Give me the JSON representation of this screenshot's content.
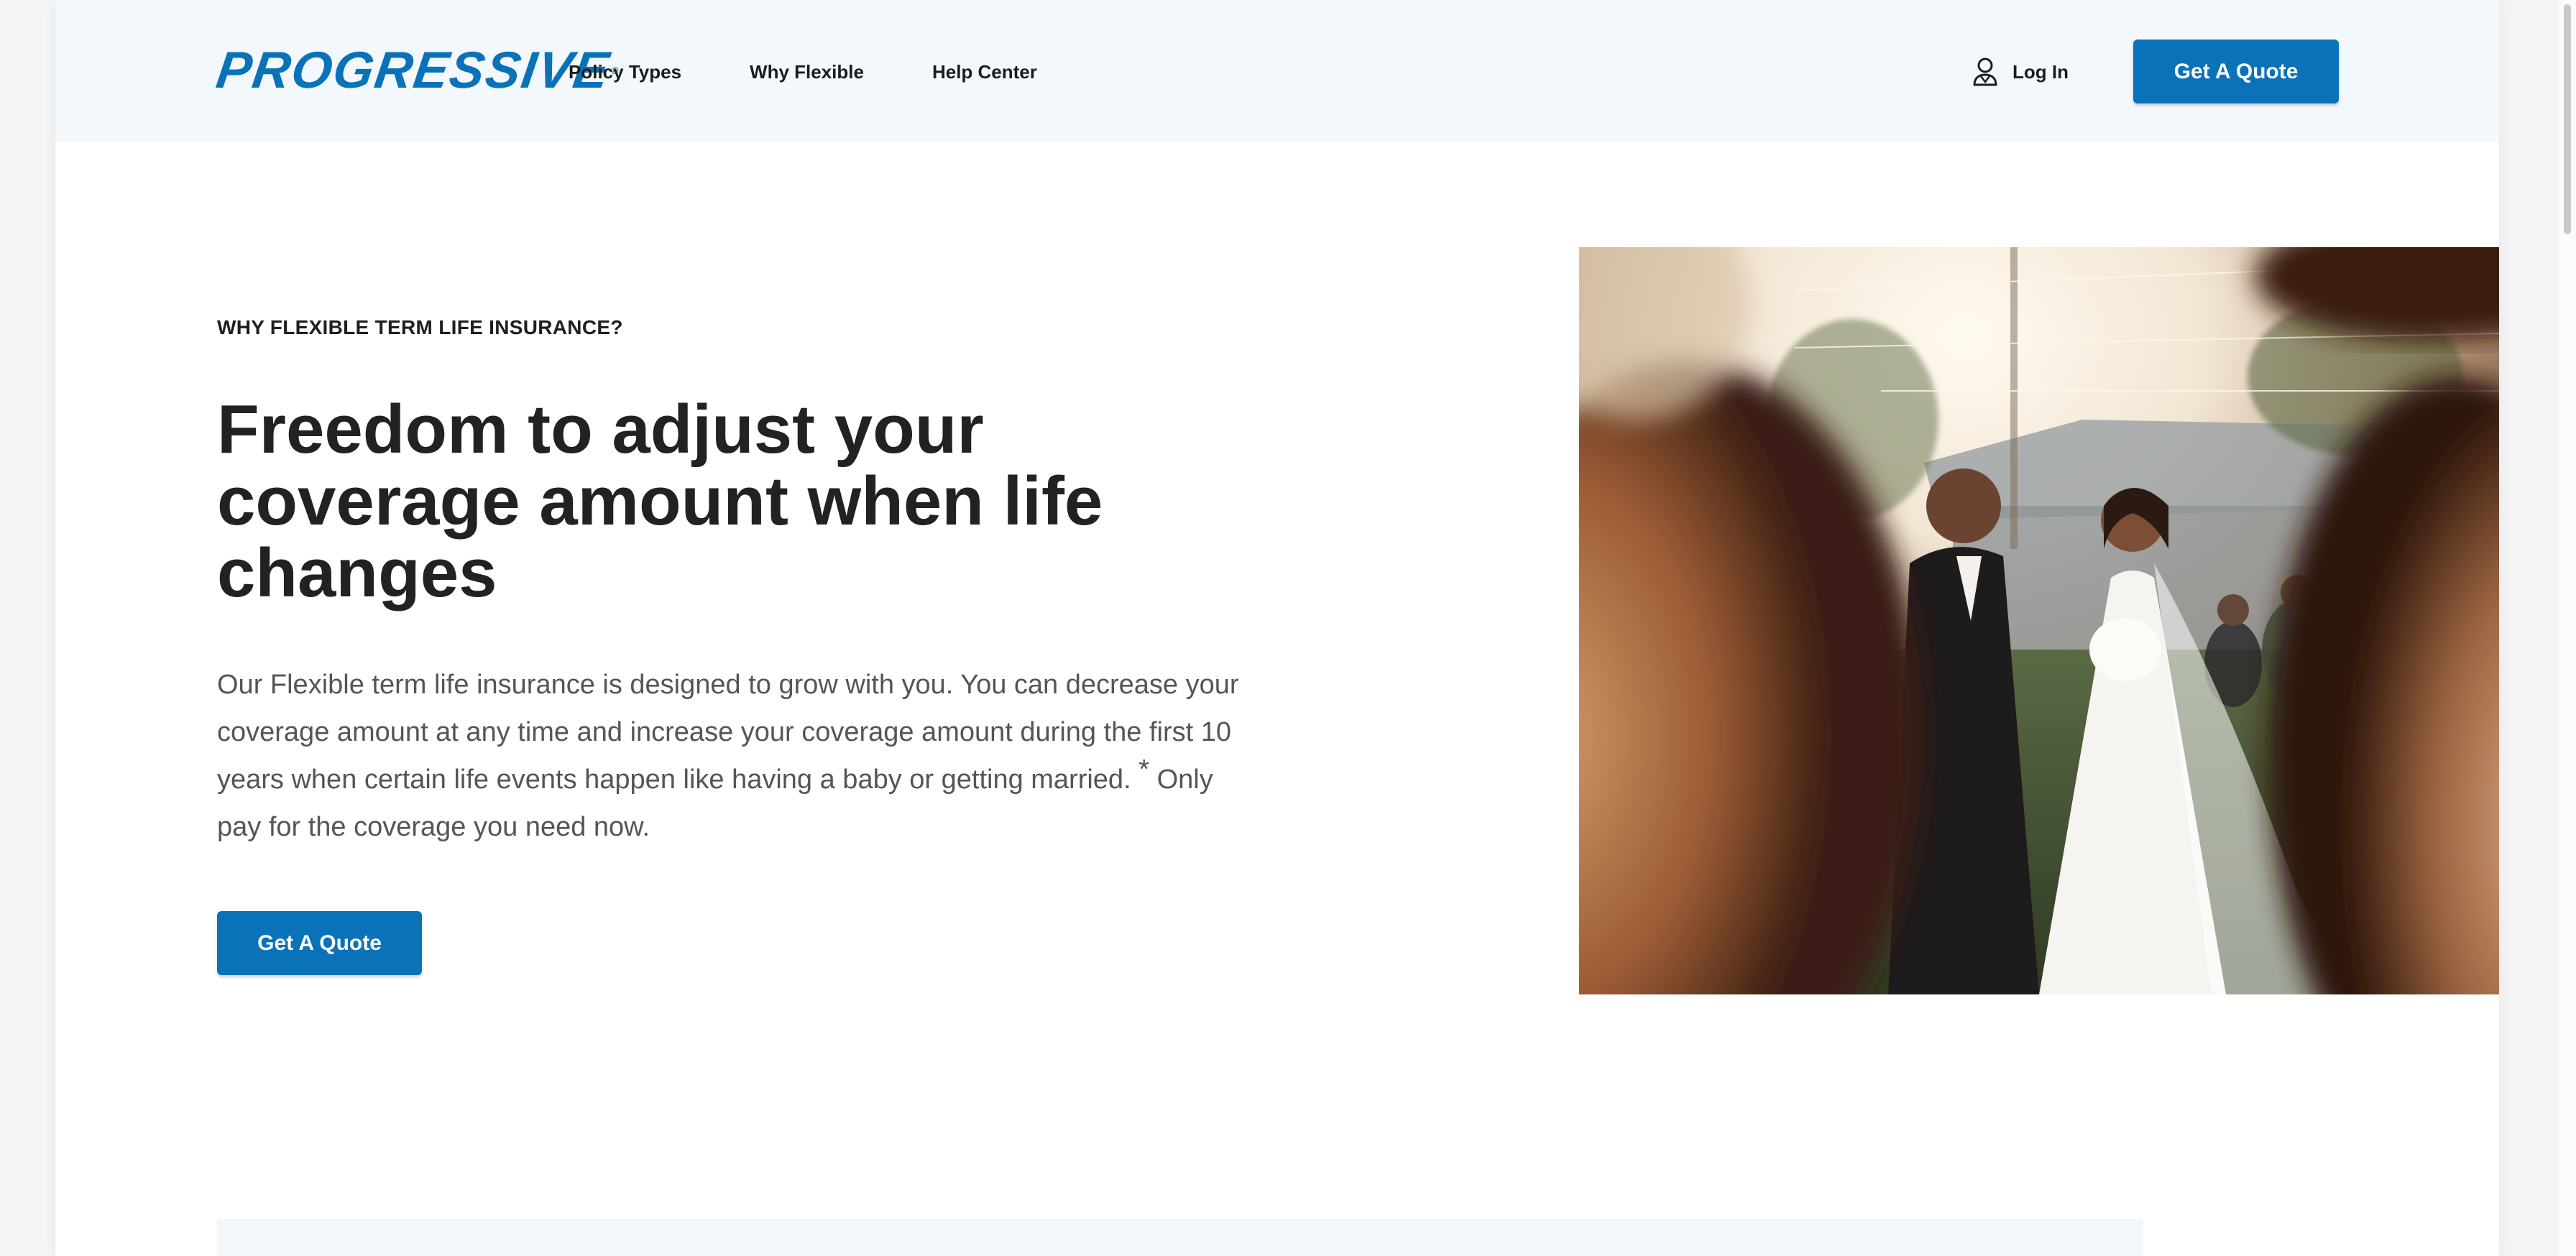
{
  "header": {
    "logo_text": "PROGRESSIVE",
    "nav": [
      "Policy Types",
      "Why Flexible",
      "Help Center"
    ],
    "login_label": "Log In",
    "cta_label": "Get A Quote"
  },
  "hero": {
    "eyebrow": "WHY FLEXIBLE TERM LIFE INSURANCE?",
    "headline": "Freedom to adjust your coverage amount when life changes",
    "body_main": "Our Flexible term life insurance is designed to grow with you. You can decrease your coverage amount at any time and increase your coverage amount during the first 10 years when certain life events happen like having a baby or getting married.",
    "body_star": "*",
    "body_tail": "Only pay for the coverage you need now.",
    "cta_label": "Get A Quote"
  },
  "colors": {
    "brand_blue": "#0a72b8",
    "header_bg": "#f3f8fc",
    "heading_text": "#222222",
    "body_text": "#555555"
  },
  "icons": {
    "login": "user-icon"
  }
}
